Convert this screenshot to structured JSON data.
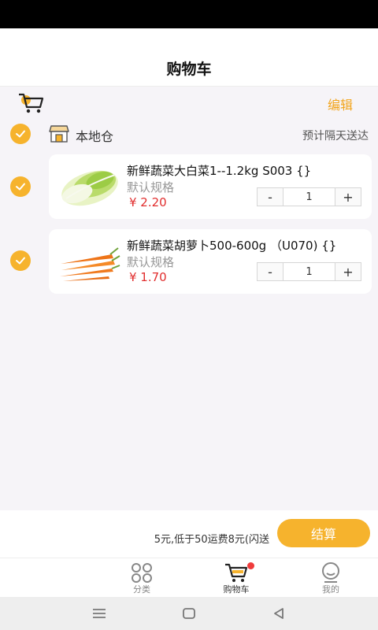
{
  "header": {
    "title": "购物车"
  },
  "toolbar": {
    "edit_label": "编辑"
  },
  "store": {
    "name": "本地仓",
    "delivery": "预计隔天送达"
  },
  "items": [
    {
      "name": "新鲜蔬菜大白菜1--1.2kg S003 {}",
      "spec": "默认规格",
      "price": "¥ 2.20",
      "qty": "1",
      "minus": "-",
      "plus": "+",
      "image": "napa-cabbage",
      "selected": true
    },
    {
      "name": "新鲜蔬菜胡萝卜500-600g （U070) {}",
      "spec": "默认规格",
      "price": "¥ 1.70",
      "qty": "1",
      "minus": "-",
      "plus": "+",
      "image": "carrots",
      "selected": true
    }
  ],
  "footer": {
    "note": "5元,低于50运费8元(闪送",
    "checkout_label": "结算"
  },
  "tabs": [
    {
      "label": "分类",
      "icon": "category-icon"
    },
    {
      "label": "购物车",
      "icon": "cart-icon",
      "badge": true
    },
    {
      "label": "我的",
      "icon": "profile-icon"
    }
  ],
  "colors": {
    "accent": "#f6b32d",
    "price": "#e12e2e",
    "edit": "#f2a41b"
  }
}
